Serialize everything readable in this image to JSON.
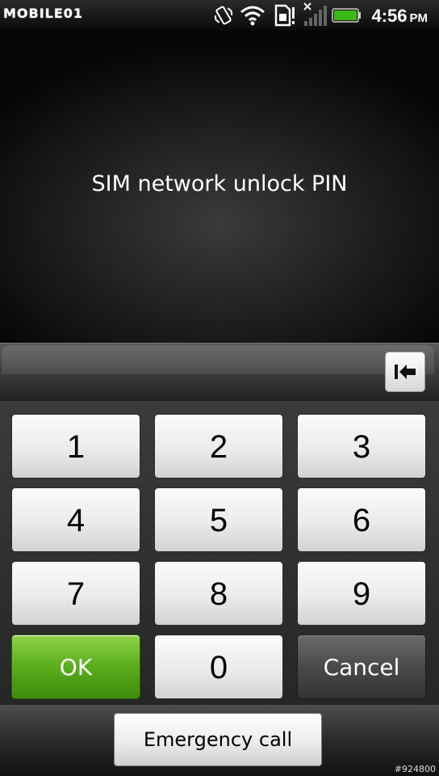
{
  "status_bar": {
    "logo_text": "MOBILE01",
    "time": "4:56",
    "ampm": "PM",
    "icons": [
      "vibrate-icon",
      "wifi-icon",
      "sim-alert-icon",
      "no-signal-icon",
      "battery-icon"
    ]
  },
  "title": "SIM network unlock PIN",
  "pin_field": {
    "value": ""
  },
  "keypad": {
    "keys": [
      {
        "label": "1"
      },
      {
        "label": "2"
      },
      {
        "label": "3"
      },
      {
        "label": "4"
      },
      {
        "label": "5"
      },
      {
        "label": "6"
      },
      {
        "label": "7"
      },
      {
        "label": "8"
      },
      {
        "label": "9"
      },
      {
        "label": "OK"
      },
      {
        "label": "0"
      },
      {
        "label": "Cancel"
      }
    ]
  },
  "emergency_call_label": "Emergency call",
  "watermark_id": "#924800",
  "colors": {
    "ok_green": "#5aad1c",
    "battery_green": "#3cb815",
    "background": "#000000"
  }
}
